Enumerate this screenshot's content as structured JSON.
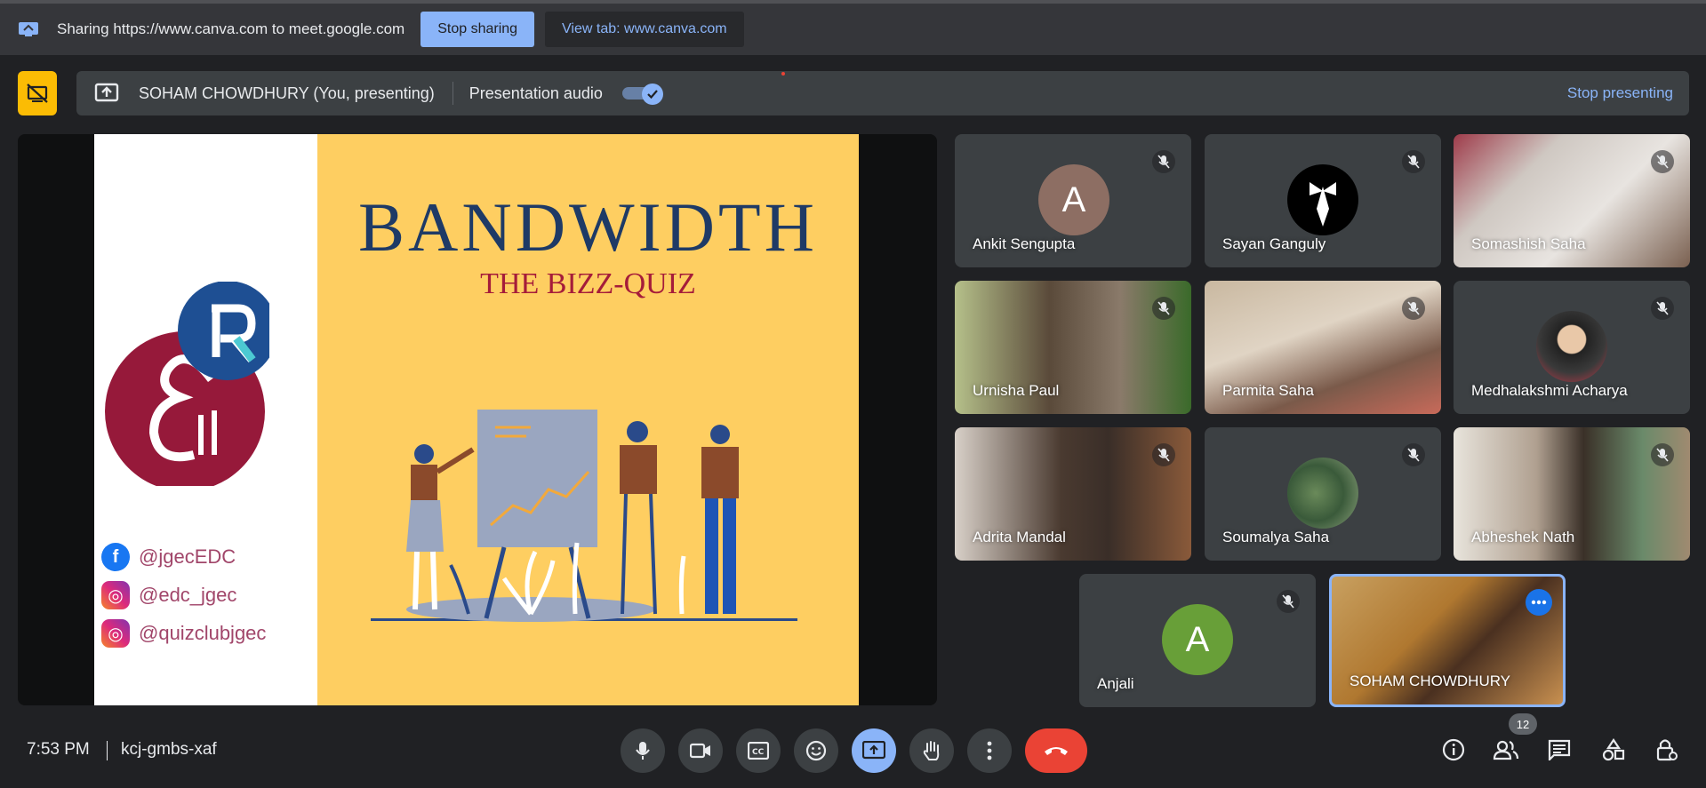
{
  "share_bar": {
    "text": "Sharing https://www.canva.com to meet.google.com",
    "stop_sharing": "Stop sharing",
    "view_tab": "View tab: www.canva.com"
  },
  "presenting_bar": {
    "presenter": "SOHAM CHOWDHURY (You, presenting)",
    "audio_label": "Presentation audio",
    "audio_enabled": true,
    "stop_presenting": "Stop presenting"
  },
  "slide": {
    "title": "BANDWIDTH",
    "subtitle": "THE BIZZ-QUIZ",
    "social": [
      {
        "icon": "facebook-icon",
        "handle": "@jgecEDC"
      },
      {
        "icon": "instagram-icon",
        "handle": "@edc_jgec"
      },
      {
        "icon": "instagram-icon",
        "handle": "@quizclubjgec"
      }
    ]
  },
  "participants": [
    {
      "name": "Ankit Sengupta",
      "avatar_letter": "A",
      "avatar_color": "#8d6e63"
    },
    {
      "name": "Sayan Ganguly"
    },
    {
      "name": "Somashish Saha"
    },
    {
      "name": "Urnisha Paul"
    },
    {
      "name": "Parmita Saha"
    },
    {
      "name": "Medhalakshmi Acharya"
    },
    {
      "name": "Adrita Mandal"
    },
    {
      "name": "Soumalya Saha"
    },
    {
      "name": "Abheshek Nath"
    },
    {
      "name": "Anjali",
      "avatar_letter": "A",
      "avatar_color": "#689f38"
    },
    {
      "name": "SOHAM CHOWDHURY"
    }
  ],
  "bottom": {
    "time": "7:53 PM",
    "meeting_code": "kcj-gmbs-xaf",
    "people_count": "12"
  },
  "colors": {
    "accent": "#8ab4f8",
    "end_call": "#ea4335",
    "present_badge": "#fbbc04"
  }
}
